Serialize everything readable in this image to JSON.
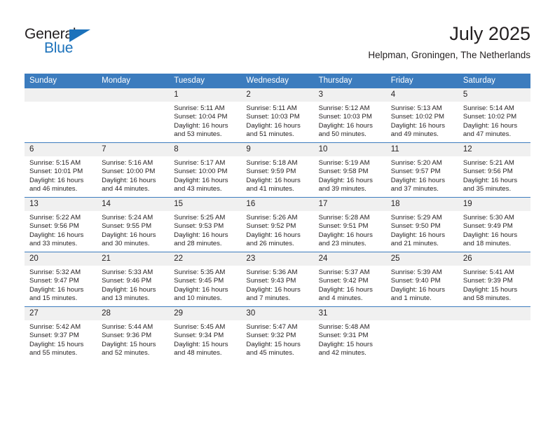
{
  "brand": {
    "name_part1": "General",
    "name_part2": "Blue",
    "triangle_icon": "blue-triangle-icon",
    "colors": {
      "dark": "#231f20",
      "blue": "#1c72bb",
      "header_blue": "#3c7cbe",
      "daynum_band": "#f0f0f0"
    }
  },
  "header": {
    "month_title": "July 2025",
    "location": "Helpman, Groningen, The Netherlands"
  },
  "calendar": {
    "weekday_headers": [
      "Sunday",
      "Monday",
      "Tuesday",
      "Wednesday",
      "Thursday",
      "Friday",
      "Saturday"
    ],
    "weeks": [
      [
        {
          "day": "",
          "empty": true,
          "lines": []
        },
        {
          "day": "",
          "empty": true,
          "lines": []
        },
        {
          "day": "1",
          "lines": [
            "Sunrise: 5:11 AM",
            "Sunset: 10:04 PM",
            "Daylight: 16 hours",
            "and 53 minutes."
          ]
        },
        {
          "day": "2",
          "lines": [
            "Sunrise: 5:11 AM",
            "Sunset: 10:03 PM",
            "Daylight: 16 hours",
            "and 51 minutes."
          ]
        },
        {
          "day": "3",
          "lines": [
            "Sunrise: 5:12 AM",
            "Sunset: 10:03 PM",
            "Daylight: 16 hours",
            "and 50 minutes."
          ]
        },
        {
          "day": "4",
          "lines": [
            "Sunrise: 5:13 AM",
            "Sunset: 10:02 PM",
            "Daylight: 16 hours",
            "and 49 minutes."
          ]
        },
        {
          "day": "5",
          "lines": [
            "Sunrise: 5:14 AM",
            "Sunset: 10:02 PM",
            "Daylight: 16 hours",
            "and 47 minutes."
          ]
        }
      ],
      [
        {
          "day": "6",
          "lines": [
            "Sunrise: 5:15 AM",
            "Sunset: 10:01 PM",
            "Daylight: 16 hours",
            "and 46 minutes."
          ]
        },
        {
          "day": "7",
          "lines": [
            "Sunrise: 5:16 AM",
            "Sunset: 10:00 PM",
            "Daylight: 16 hours",
            "and 44 minutes."
          ]
        },
        {
          "day": "8",
          "lines": [
            "Sunrise: 5:17 AM",
            "Sunset: 10:00 PM",
            "Daylight: 16 hours",
            "and 43 minutes."
          ]
        },
        {
          "day": "9",
          "lines": [
            "Sunrise: 5:18 AM",
            "Sunset: 9:59 PM",
            "Daylight: 16 hours",
            "and 41 minutes."
          ]
        },
        {
          "day": "10",
          "lines": [
            "Sunrise: 5:19 AM",
            "Sunset: 9:58 PM",
            "Daylight: 16 hours",
            "and 39 minutes."
          ]
        },
        {
          "day": "11",
          "lines": [
            "Sunrise: 5:20 AM",
            "Sunset: 9:57 PM",
            "Daylight: 16 hours",
            "and 37 minutes."
          ]
        },
        {
          "day": "12",
          "lines": [
            "Sunrise: 5:21 AM",
            "Sunset: 9:56 PM",
            "Daylight: 16 hours",
            "and 35 minutes."
          ]
        }
      ],
      [
        {
          "day": "13",
          "lines": [
            "Sunrise: 5:22 AM",
            "Sunset: 9:56 PM",
            "Daylight: 16 hours",
            "and 33 minutes."
          ]
        },
        {
          "day": "14",
          "lines": [
            "Sunrise: 5:24 AM",
            "Sunset: 9:55 PM",
            "Daylight: 16 hours",
            "and 30 minutes."
          ]
        },
        {
          "day": "15",
          "lines": [
            "Sunrise: 5:25 AM",
            "Sunset: 9:53 PM",
            "Daylight: 16 hours",
            "and 28 minutes."
          ]
        },
        {
          "day": "16",
          "lines": [
            "Sunrise: 5:26 AM",
            "Sunset: 9:52 PM",
            "Daylight: 16 hours",
            "and 26 minutes."
          ]
        },
        {
          "day": "17",
          "lines": [
            "Sunrise: 5:28 AM",
            "Sunset: 9:51 PM",
            "Daylight: 16 hours",
            "and 23 minutes."
          ]
        },
        {
          "day": "18",
          "lines": [
            "Sunrise: 5:29 AM",
            "Sunset: 9:50 PM",
            "Daylight: 16 hours",
            "and 21 minutes."
          ]
        },
        {
          "day": "19",
          "lines": [
            "Sunrise: 5:30 AM",
            "Sunset: 9:49 PM",
            "Daylight: 16 hours",
            "and 18 minutes."
          ]
        }
      ],
      [
        {
          "day": "20",
          "lines": [
            "Sunrise: 5:32 AM",
            "Sunset: 9:47 PM",
            "Daylight: 16 hours",
            "and 15 minutes."
          ]
        },
        {
          "day": "21",
          "lines": [
            "Sunrise: 5:33 AM",
            "Sunset: 9:46 PM",
            "Daylight: 16 hours",
            "and 13 minutes."
          ]
        },
        {
          "day": "22",
          "lines": [
            "Sunrise: 5:35 AM",
            "Sunset: 9:45 PM",
            "Daylight: 16 hours",
            "and 10 minutes."
          ]
        },
        {
          "day": "23",
          "lines": [
            "Sunrise: 5:36 AM",
            "Sunset: 9:43 PM",
            "Daylight: 16 hours",
            "and 7 minutes."
          ]
        },
        {
          "day": "24",
          "lines": [
            "Sunrise: 5:37 AM",
            "Sunset: 9:42 PM",
            "Daylight: 16 hours",
            "and 4 minutes."
          ]
        },
        {
          "day": "25",
          "lines": [
            "Sunrise: 5:39 AM",
            "Sunset: 9:40 PM",
            "Daylight: 16 hours",
            "and 1 minute."
          ]
        },
        {
          "day": "26",
          "lines": [
            "Sunrise: 5:41 AM",
            "Sunset: 9:39 PM",
            "Daylight: 15 hours",
            "and 58 minutes."
          ]
        }
      ],
      [
        {
          "day": "27",
          "lines": [
            "Sunrise: 5:42 AM",
            "Sunset: 9:37 PM",
            "Daylight: 15 hours",
            "and 55 minutes."
          ]
        },
        {
          "day": "28",
          "lines": [
            "Sunrise: 5:44 AM",
            "Sunset: 9:36 PM",
            "Daylight: 15 hours",
            "and 52 minutes."
          ]
        },
        {
          "day": "29",
          "lines": [
            "Sunrise: 5:45 AM",
            "Sunset: 9:34 PM",
            "Daylight: 15 hours",
            "and 48 minutes."
          ]
        },
        {
          "day": "30",
          "lines": [
            "Sunrise: 5:47 AM",
            "Sunset: 9:32 PM",
            "Daylight: 15 hours",
            "and 45 minutes."
          ]
        },
        {
          "day": "31",
          "lines": [
            "Sunrise: 5:48 AM",
            "Sunset: 9:31 PM",
            "Daylight: 15 hours",
            "and 42 minutes."
          ]
        },
        {
          "day": "",
          "empty": true,
          "lines": []
        },
        {
          "day": "",
          "empty": true,
          "lines": []
        }
      ]
    ]
  }
}
